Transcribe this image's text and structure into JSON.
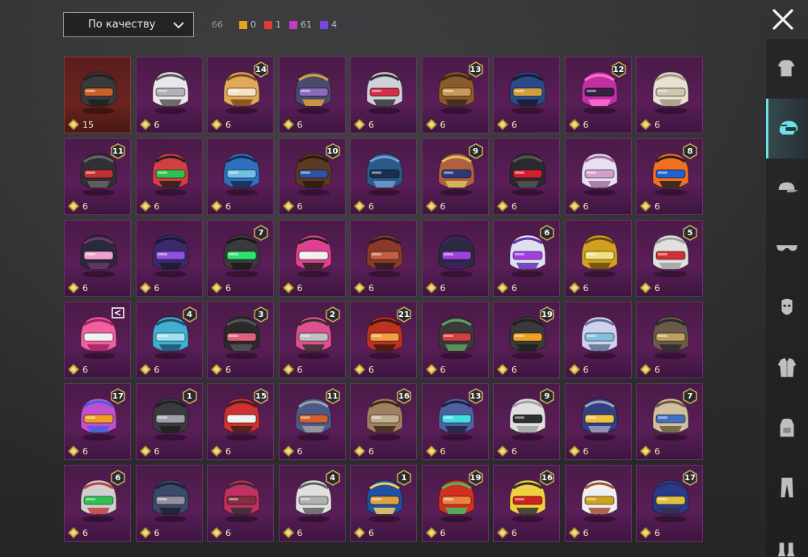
{
  "toolbar": {
    "sort_label": "По качеству",
    "total_count": "66",
    "counts": [
      {
        "value": "0",
        "color": "#e8a21c"
      },
      {
        "value": "1",
        "color": "#e03a3a"
      },
      {
        "value": "61",
        "color": "#c43ac8"
      },
      {
        "value": "4",
        "color": "#7a44e0"
      }
    ]
  },
  "colors": {
    "accent": "#6ee0e8",
    "rarity_purple": "#5a1e57",
    "rarity_red": "#6a2420"
  },
  "items": [
    {
      "cost": "15",
      "badge": "",
      "rarity": "red"
    },
    {
      "cost": "6",
      "badge": "",
      "rarity": "purple"
    },
    {
      "cost": "6",
      "badge": "14",
      "rarity": "purple"
    },
    {
      "cost": "6",
      "badge": "",
      "rarity": "purple"
    },
    {
      "cost": "6",
      "badge": "",
      "rarity": "purple"
    },
    {
      "cost": "6",
      "badge": "13",
      "rarity": "purple"
    },
    {
      "cost": "6",
      "badge": "",
      "rarity": "purple"
    },
    {
      "cost": "6",
      "badge": "12",
      "rarity": "purple"
    },
    {
      "cost": "6",
      "badge": "",
      "rarity": "purple"
    },
    {
      "cost": "6",
      "badge": "11",
      "rarity": "purple"
    },
    {
      "cost": "6",
      "badge": "",
      "rarity": "purple"
    },
    {
      "cost": "6",
      "badge": "",
      "rarity": "purple"
    },
    {
      "cost": "6",
      "badge": "10",
      "rarity": "purple"
    },
    {
      "cost": "6",
      "badge": "",
      "rarity": "purple"
    },
    {
      "cost": "6",
      "badge": "9",
      "rarity": "purple"
    },
    {
      "cost": "6",
      "badge": "",
      "rarity": "purple"
    },
    {
      "cost": "6",
      "badge": "",
      "rarity": "purple"
    },
    {
      "cost": "6",
      "badge": "8",
      "rarity": "purple"
    },
    {
      "cost": "6",
      "badge": "",
      "rarity": "purple"
    },
    {
      "cost": "6",
      "badge": "",
      "rarity": "purple"
    },
    {
      "cost": "6",
      "badge": "7",
      "rarity": "purple"
    },
    {
      "cost": "6",
      "badge": "",
      "rarity": "purple"
    },
    {
      "cost": "6",
      "badge": "",
      "rarity": "purple"
    },
    {
      "cost": "6",
      "badge": "",
      "rarity": "purple"
    },
    {
      "cost": "6",
      "badge": "6",
      "rarity": "purple"
    },
    {
      "cost": "6",
      "badge": "",
      "rarity": "purple"
    },
    {
      "cost": "6",
      "badge": "5",
      "rarity": "purple"
    },
    {
      "cost": "6",
      "badge": "",
      "rarity": "purple",
      "mark": true
    },
    {
      "cost": "6",
      "badge": "4",
      "rarity": "purple"
    },
    {
      "cost": "6",
      "badge": "3",
      "rarity": "purple"
    },
    {
      "cost": "6",
      "badge": "2",
      "rarity": "purple"
    },
    {
      "cost": "6",
      "badge": "21",
      "rarity": "purple"
    },
    {
      "cost": "6",
      "badge": "",
      "rarity": "purple"
    },
    {
      "cost": "6",
      "badge": "19",
      "rarity": "purple"
    },
    {
      "cost": "6",
      "badge": "",
      "rarity": "purple"
    },
    {
      "cost": "6",
      "badge": "",
      "rarity": "purple"
    },
    {
      "cost": "6",
      "badge": "17",
      "rarity": "purple"
    },
    {
      "cost": "6",
      "badge": "1",
      "rarity": "purple"
    },
    {
      "cost": "6",
      "badge": "15",
      "rarity": "purple"
    },
    {
      "cost": "6",
      "badge": "11",
      "rarity": "purple"
    },
    {
      "cost": "6",
      "badge": "16",
      "rarity": "purple"
    },
    {
      "cost": "6",
      "badge": "13",
      "rarity": "purple"
    },
    {
      "cost": "6",
      "badge": "9",
      "rarity": "purple"
    },
    {
      "cost": "6",
      "badge": "",
      "rarity": "purple"
    },
    {
      "cost": "6",
      "badge": "7",
      "rarity": "purple"
    },
    {
      "cost": "6",
      "badge": "6",
      "rarity": "purple"
    },
    {
      "cost": "6",
      "badge": "",
      "rarity": "purple"
    },
    {
      "cost": "6",
      "badge": "",
      "rarity": "purple"
    },
    {
      "cost": "6",
      "badge": "4",
      "rarity": "purple"
    },
    {
      "cost": "6",
      "badge": "1",
      "rarity": "purple"
    },
    {
      "cost": "6",
      "badge": "19",
      "rarity": "purple"
    },
    {
      "cost": "6",
      "badge": "16",
      "rarity": "purple"
    },
    {
      "cost": "6",
      "badge": "",
      "rarity": "purple"
    },
    {
      "cost": "6",
      "badge": "17",
      "rarity": "purple"
    }
  ],
  "sidebar": [
    {
      "icon": "outfit-icon"
    },
    {
      "icon": "helmet-icon",
      "active": true
    },
    {
      "icon": "cap-icon"
    },
    {
      "icon": "glasses-icon"
    },
    {
      "icon": "mask-icon"
    },
    {
      "icon": "jacket-icon"
    },
    {
      "icon": "backpack-icon"
    },
    {
      "icon": "pants-icon"
    },
    {
      "icon": "shoes-icon"
    }
  ]
}
